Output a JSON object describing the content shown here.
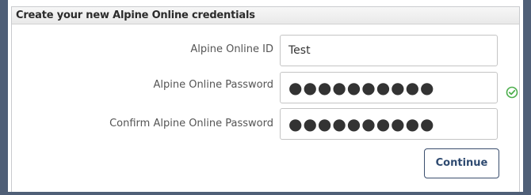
{
  "header": {
    "title": "Create your new Alpine Online credentials"
  },
  "form": {
    "id_label": "Alpine Online ID",
    "id_value": "Test",
    "password_label": "Alpine Online Password",
    "password_value": "●●●●●●●●●●",
    "confirm_label": "Confirm Alpine Online Password",
    "confirm_value": "●●●●●●●●●●",
    "password_valid_icon": "check-circle-icon"
  },
  "actions": {
    "continue_label": "Continue"
  },
  "colors": {
    "frame": "#4f5f77",
    "check_green": "#4cae4c",
    "button_text": "#2e4a70"
  }
}
